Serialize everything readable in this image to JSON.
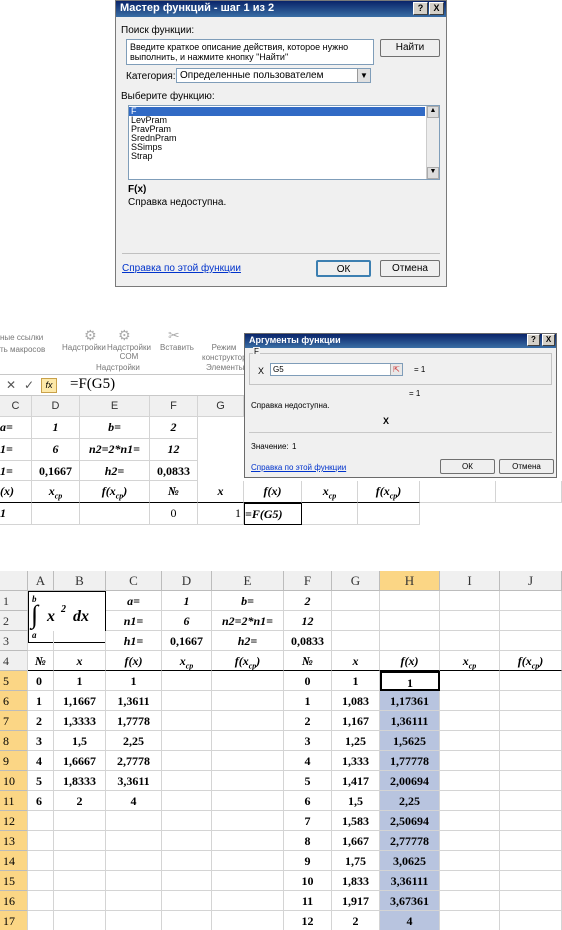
{
  "dialog1": {
    "title": "Мастер функций - шаг 1 из 2",
    "help_btn": "?",
    "close_btn": "X",
    "search_label": "Поиск функции:",
    "search_text": "Введите краткое описание действия, которое нужно выполнить, и нажмите кнопку \"Найти\"",
    "find_button": "Найти",
    "category_label": "Категория:",
    "category_value": "Определенные пользователем",
    "choose_label": "Выберите функцию:",
    "functions": [
      "F",
      "LevPram",
      "PravPram",
      "SrednPram",
      "SSimps",
      "Strap"
    ],
    "selected_signature": "F(x)",
    "description": "Справка недоступна.",
    "help_link": "Справка по этой функции",
    "ok": "ОК",
    "cancel": "Отмена"
  },
  "ribbon": {
    "links_label": "ные ссылки",
    "macros_label": "ть макросов",
    "addins1": "Надстройки",
    "addins_com": "Надстройки COM",
    "insert": "Вставить",
    "mode": "Режим конструктора",
    "group_addins": "Надстройки",
    "group_elements": "Элементы"
  },
  "formula_bar": {
    "cancel": "✕",
    "enter": "✓",
    "fx": "fx",
    "formula": "=F(G5)"
  },
  "mid_grid": {
    "columns": [
      "C",
      "D",
      "E",
      "F",
      "G"
    ],
    "rows": [
      [
        "a=",
        "1",
        "b=",
        "2",
        ""
      ],
      [
        "1=",
        "6",
        "n2=2*n1=",
        "12",
        ""
      ],
      [
        "1=",
        "0,1667",
        "h2=",
        "0,0833",
        ""
      ],
      [
        "(x)",
        "x cp",
        "f(x cp)",
        "№",
        "x"
      ],
      [
        "1",
        "",
        "",
        "0",
        "1"
      ]
    ],
    "extra_row4": [
      "f(x)",
      "x cp",
      "f(x cp)"
    ],
    "extra_row5": [
      "=F(G5)"
    ]
  },
  "dialog2": {
    "title": "Аргументы функции",
    "help_btn": "?",
    "close_btn": "X",
    "group": "F",
    "arg_label": "X",
    "arg_value": "G5",
    "arg_result": "= 1",
    "total_result": "= 1",
    "description": "Справка недоступна.",
    "param_name": "X",
    "value_label": "Значение:",
    "value": "1",
    "help_link": "Справка по этой функции",
    "ok": "ОК",
    "cancel": "Отмена"
  },
  "sheet": {
    "columns": [
      "A",
      "B",
      "C",
      "D",
      "E",
      "F",
      "G",
      "H",
      "I",
      "J"
    ],
    "row_numbers": [
      "1",
      "2",
      "3",
      "4",
      "5",
      "6",
      "7",
      "8",
      "9",
      "10",
      "11",
      "12",
      "13",
      "14",
      "15",
      "16",
      "17"
    ],
    "integral": {
      "upper": "b",
      "lower": "a",
      "body": "x",
      "power": "2",
      "dx": "dx"
    },
    "params": {
      "a_label": "a=",
      "a": "1",
      "b_label": "b=",
      "b": "2",
      "n1_label": "n1=",
      "n1": "6",
      "n2_label": "n2=2*n1=",
      "n2": "12",
      "h1_label": "h1=",
      "h1": "0,1667",
      "h2_label": "h2=",
      "h2": "0,0833"
    },
    "headers": [
      "№",
      "x",
      "f(x)",
      "x cp",
      "f(x cp)",
      "№",
      "x",
      "f(x)",
      "x cp",
      "f(x cp)"
    ],
    "left_table": [
      [
        "0",
        "1",
        "1"
      ],
      [
        "1",
        "1,1667",
        "1,3611"
      ],
      [
        "2",
        "1,3333",
        "1,7778"
      ],
      [
        "3",
        "1,5",
        "2,25"
      ],
      [
        "4",
        "1,6667",
        "2,7778"
      ],
      [
        "5",
        "1,8333",
        "3,3611"
      ],
      [
        "6",
        "2",
        "4"
      ]
    ],
    "right_table": [
      [
        "0",
        "1",
        "1"
      ],
      [
        "1",
        "1,083",
        "1,17361"
      ],
      [
        "2",
        "1,167",
        "1,36111"
      ],
      [
        "3",
        "1,25",
        "1,5625"
      ],
      [
        "4",
        "1,333",
        "1,77778"
      ],
      [
        "5",
        "1,417",
        "2,00694"
      ],
      [
        "6",
        "1,5",
        "2,25"
      ],
      [
        "7",
        "1,583",
        "2,50694"
      ],
      [
        "8",
        "1,667",
        "2,77778"
      ],
      [
        "9",
        "1,75",
        "3,0625"
      ],
      [
        "10",
        "1,833",
        "3,36111"
      ],
      [
        "11",
        "1,917",
        "3,67361"
      ],
      [
        "12",
        "2",
        "4"
      ]
    ]
  },
  "colors": {
    "title_bar": "#0a246a",
    "selection": "#b8c4df",
    "header_selected": "#fbd685",
    "link": "#0033cc"
  }
}
